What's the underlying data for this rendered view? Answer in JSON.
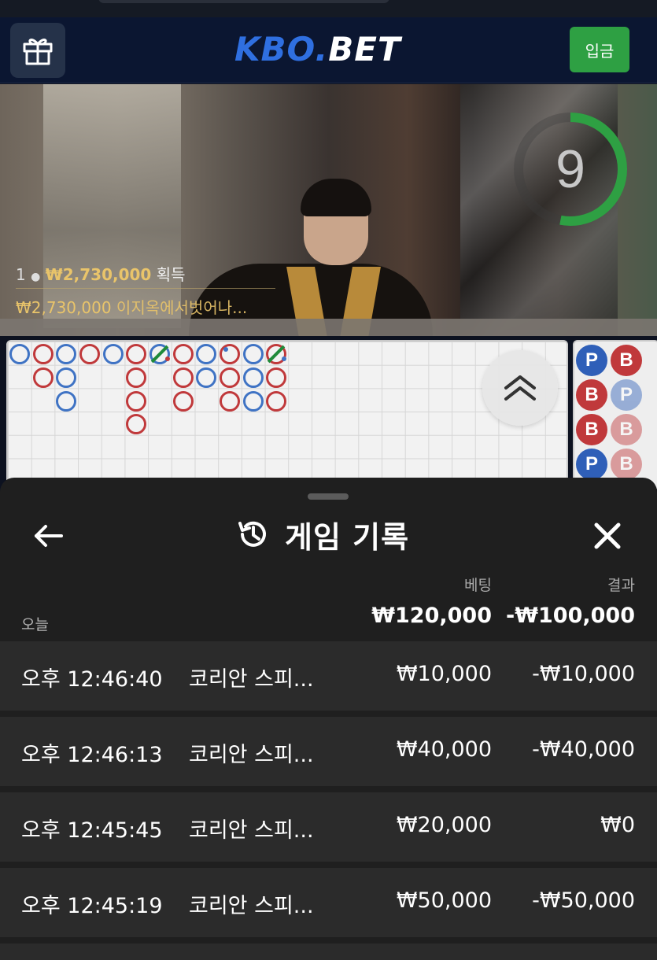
{
  "header": {
    "logo_part1": "KBO.",
    "logo_part2": "BET",
    "deposit_label": "입금"
  },
  "video": {
    "countdown": "9",
    "winner_count": "1",
    "winner_amount": "₩2,730,000",
    "winner_label": "획득",
    "chat_amount": "₩2,730,000",
    "chat_message": "이지옥에서벗어나..."
  },
  "history": {
    "title": "게임 기록",
    "col_bet": "베팅",
    "col_result": "결과",
    "today_label": "오늘",
    "total_bet": "₩120,000",
    "total_result": "-₩100,000",
    "rows": [
      {
        "time": "오후 12:46:40",
        "game": "코리안 스피...",
        "bet": "₩10,000",
        "result": "-₩10,000"
      },
      {
        "time": "오후 12:46:13",
        "game": "코리안 스피...",
        "bet": "₩40,000",
        "result": "-₩40,000"
      },
      {
        "time": "오후 12:45:45",
        "game": "코리안 스피...",
        "bet": "₩20,000",
        "result": "₩0"
      },
      {
        "time": "오후 12:45:19",
        "game": "코리안 스피...",
        "bet": "₩50,000",
        "result": "-₩50,000"
      }
    ]
  },
  "colors": {
    "header_bg": "#0b1631",
    "deposit_green": "#2ea043",
    "banker_red": "#c0393b",
    "player_blue": "#3f73c4",
    "tie_green": "#1f8a3a",
    "sheet_bg": "#1f1f1f",
    "row_bg": "#2b2b2b",
    "win_gold": "#e9c46a"
  },
  "roadmap_side_labels": [
    "P",
    "B",
    "B",
    "P",
    "B",
    "B",
    "P",
    "B"
  ]
}
